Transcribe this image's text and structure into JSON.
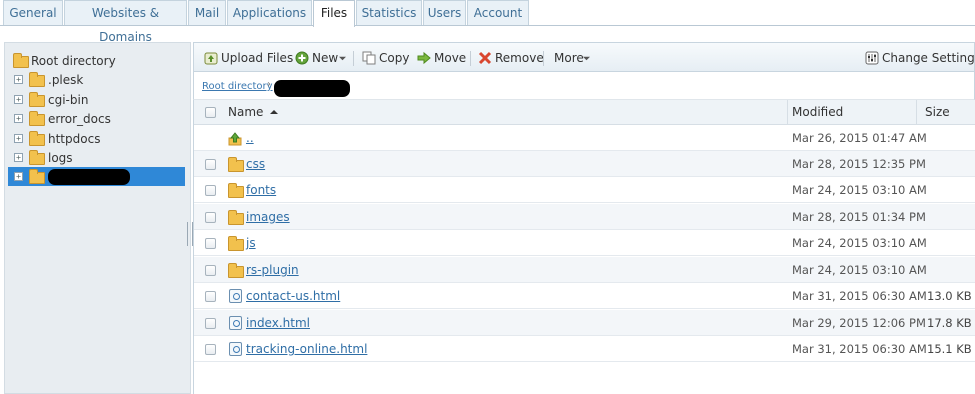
{
  "tabs": [
    {
      "label": "General"
    },
    {
      "label": "Websites & Domains"
    },
    {
      "label": "Mail"
    },
    {
      "label": "Applications"
    },
    {
      "label": "Files"
    },
    {
      "label": "Statistics"
    },
    {
      "label": "Users"
    },
    {
      "label": "Account"
    }
  ],
  "active_tab": "Files",
  "tree": {
    "root_label": "Root directory",
    "items": [
      {
        "label": ".plesk"
      },
      {
        "label": "cgi-bin"
      },
      {
        "label": "error_docs"
      },
      {
        "label": "httpdocs"
      },
      {
        "label": "logs"
      }
    ],
    "expander_symbol": "+"
  },
  "toolbar": {
    "upload": "Upload Files",
    "new": "New",
    "copy": "Copy",
    "move": "Move",
    "remove": "Remove",
    "more": "More",
    "settings": "Change Settings"
  },
  "breadcrumb": {
    "root_link": "Root directory",
    "separator": "›"
  },
  "table": {
    "headers": {
      "name": "Name",
      "modified": "Modified",
      "size": "Size"
    },
    "rows": [
      {
        "name": "..",
        "type": "up",
        "modified": "Mar 26, 2015 01:47 AM",
        "size": ""
      },
      {
        "name": "css",
        "type": "folder",
        "modified": "Mar 28, 2015 12:35 PM",
        "size": ""
      },
      {
        "name": "fonts",
        "type": "folder",
        "modified": "Mar 24, 2015 03:10 AM",
        "size": ""
      },
      {
        "name": "images",
        "type": "folder",
        "modified": "Mar 28, 2015 01:34 PM",
        "size": ""
      },
      {
        "name": "js",
        "type": "folder",
        "modified": "Mar 24, 2015 03:10 AM",
        "size": ""
      },
      {
        "name": "rs-plugin",
        "type": "folder",
        "modified": "Mar 24, 2015 03:10 AM",
        "size": ""
      },
      {
        "name": "contact-us.html",
        "type": "file",
        "modified": "Mar 31, 2015 06:30 AM",
        "size": "13.0 KB"
      },
      {
        "name": "index.html",
        "type": "file",
        "modified": "Mar 29, 2015 12:06 PM",
        "size": "17.8 KB"
      },
      {
        "name": "tracking-online.html",
        "type": "file",
        "modified": "Mar 31, 2015 06:30 AM",
        "size": "15.1 KB"
      }
    ]
  },
  "colors": {
    "selected": "#2f88d7",
    "link": "#2f6ea6",
    "folder": "#f2c14d"
  }
}
